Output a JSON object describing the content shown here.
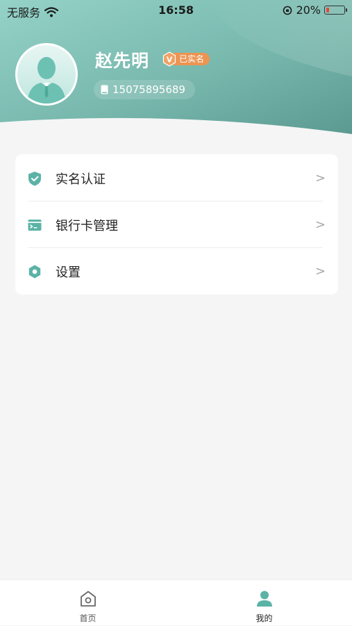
{
  "status_bar": {
    "carrier": "无服务",
    "time": "16:58",
    "battery_percent": "20%",
    "battery_level": 0.2
  },
  "profile": {
    "name": "赵先明",
    "verified_badge": "已实名",
    "badge_icon_letter": "V",
    "phone": "15075895689"
  },
  "menu": {
    "items": [
      {
        "label": "实名认证",
        "icon": "shield-check-icon",
        "arrow": ">"
      },
      {
        "label": "银行卡管理",
        "icon": "bank-card-icon",
        "arrow": ">"
      },
      {
        "label": "设置",
        "icon": "gear-icon",
        "arrow": ">"
      }
    ]
  },
  "tabbar": {
    "tabs": [
      {
        "label": "首页",
        "icon": "home-icon",
        "active": false
      },
      {
        "label": "我的",
        "icon": "user-icon",
        "active": true
      }
    ]
  },
  "colors": {
    "accent": "#5bb3a6",
    "header_gradient_start": "#8ecdc3",
    "header_gradient_end": "#5f9e95",
    "badge": "#ec9452",
    "active_tab_text": "#222222",
    "inactive_tab_text": "#555555"
  }
}
